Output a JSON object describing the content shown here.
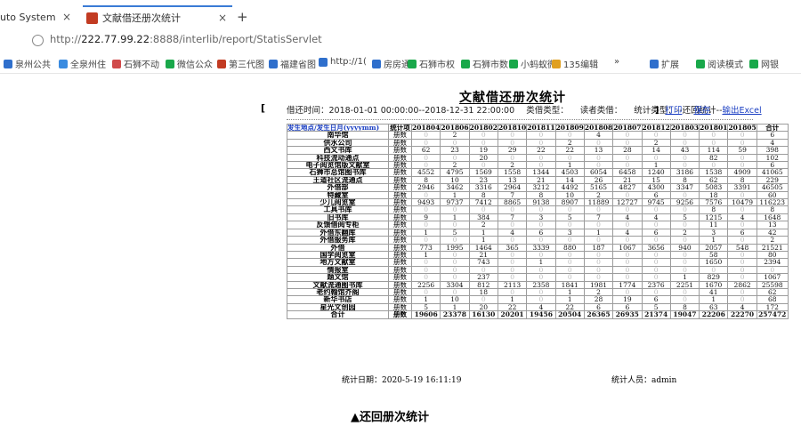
{
  "browser": {
    "tab1_title": "uto System",
    "tab2_title": "文献借还册次统计",
    "new_tab": "+",
    "url_prefix": "http://",
    "url_host": "222.77.99.22",
    "url_rest": ":8888/interlib/report/StatisServlet",
    "bookmarks": [
      "泉州公共",
      "全泉州住",
      "石狮不动",
      "微信公众",
      "第三代图",
      "福建省图",
      "http://1(",
      "房房通",
      "石狮市权",
      "石狮市数",
      "小蚂蚁微",
      "135编辑",
      "»",
      "扩展",
      "阅读模式",
      "网银"
    ]
  },
  "report": {
    "title": "文献借还册次统计",
    "period_label": "借还时间：2018-01-01 00:00:00--2018-12-31 22:00:00",
    "kind_label": "类借类型：",
    "reader_label": "读者类借：",
    "stat_type_label": "统计类型：--还回统计--",
    "left_bracket": "[",
    "right_bracket": "]",
    "btn_print": "打印",
    "btn_save": "保存",
    "btn_export": "输出Excel",
    "header_first": "发生地点/发生日月(yyyymm)",
    "header_type": "统计项",
    "months": [
      "201804",
      "201806",
      "201802",
      "201810",
      "201811",
      "201809",
      "201808",
      "201807",
      "201812",
      "201803",
      "201801",
      "201805",
      "合计"
    ],
    "rows": [
      {
        "name": "南华馆",
        "type": "册数",
        "vals": [
          "0",
          "2",
          "0",
          "0",
          "0",
          "0",
          "4",
          "0",
          "0",
          "0",
          "0",
          "0",
          "6"
        ]
      },
      {
        "name": "供水公司",
        "type": "册数",
        "vals": [
          "0",
          "0",
          "0",
          "0",
          "0",
          "2",
          "0",
          "0",
          "2",
          "0",
          "0",
          "0",
          "4"
        ]
      },
      {
        "name": "西文书库",
        "type": "册数",
        "vals": [
          "62",
          "23",
          "19",
          "29",
          "22",
          "22",
          "13",
          "28",
          "14",
          "43",
          "114",
          "59",
          "398"
        ]
      },
      {
        "name": "科技流动通点",
        "type": "册数",
        "vals": [
          "0",
          "0",
          "20",
          "0",
          "0",
          "0",
          "0",
          "0",
          "0",
          "0",
          "82",
          "0",
          "102"
        ]
      },
      {
        "name": "电子阅览馆版文献室",
        "type": "册数",
        "vals": [
          "0",
          "2",
          "0",
          "2",
          "0",
          "1",
          "0",
          "0",
          "1",
          "0",
          "0",
          "0",
          "6"
        ]
      },
      {
        "name": "石狮市总馆图书库",
        "type": "册数",
        "vals": [
          "4552",
          "4795",
          "1569",
          "1558",
          "1344",
          "4503",
          "6054",
          "6458",
          "1240",
          "3186",
          "1538",
          "4909",
          "41065"
        ]
      },
      {
        "name": "王道社区流通点",
        "type": "册数",
        "vals": [
          "8",
          "10",
          "23",
          "13",
          "21",
          "14",
          "26",
          "21",
          "15",
          "8",
          "62",
          "8",
          "229"
        ]
      },
      {
        "name": "外借部",
        "type": "册数",
        "vals": [
          "2946",
          "3462",
          "3316",
          "2964",
          "3212",
          "4492",
          "5165",
          "4827",
          "4300",
          "3347",
          "5083",
          "3391",
          "46505"
        ]
      },
      {
        "name": "特藏室",
        "type": "册数",
        "vals": [
          "0",
          "1",
          "8",
          "7",
          "8",
          "10",
          "2",
          "0",
          "6",
          "0",
          "18",
          "0",
          "60"
        ]
      },
      {
        "name": "少儿阅览室",
        "type": "册数",
        "vals": [
          "9493",
          "9737",
          "7412",
          "8865",
          "9138",
          "8907",
          "11889",
          "12727",
          "9745",
          "9256",
          "7576",
          "10479",
          "116223"
        ]
      },
      {
        "name": "工具书库",
        "type": "册数",
        "vals": [
          "0",
          "0",
          "0",
          "0",
          "0",
          "0",
          "0",
          "0",
          "0",
          "0",
          "8",
          "0",
          "8"
        ]
      },
      {
        "name": "旧书库",
        "type": "册数",
        "vals": [
          "9",
          "1",
          "384",
          "7",
          "3",
          "5",
          "7",
          "4",
          "4",
          "5",
          "1215",
          "4",
          "1648"
        ]
      },
      {
        "name": "反馈借阅专柜",
        "type": "册数",
        "vals": [
          "0",
          "0",
          "2",
          "0",
          "0",
          "0",
          "0",
          "0",
          "0",
          "0",
          "11",
          "0",
          "13"
        ]
      },
      {
        "name": "外借东翻库",
        "type": "册数",
        "vals": [
          "1",
          "5",
          "1",
          "4",
          "6",
          "3",
          "1",
          "4",
          "6",
          "2",
          "3",
          "6",
          "42"
        ]
      },
      {
        "name": "外借服务库",
        "type": "册数",
        "vals": [
          "0",
          "0",
          "1",
          "0",
          "0",
          "0",
          "0",
          "0",
          "0",
          "0",
          "1",
          "0",
          "2"
        ]
      },
      {
        "name": "外借",
        "type": "册数",
        "vals": [
          "773",
          "1995",
          "1464",
          "365",
          "3339",
          "880",
          "187",
          "1067",
          "3656",
          "940",
          "2057",
          "548",
          "21521"
        ]
      },
      {
        "name": "国学阅览室",
        "type": "册数",
        "vals": [
          "1",
          "0",
          "21",
          "0",
          "0",
          "0",
          "0",
          "0",
          "0",
          "0",
          "58",
          "0",
          "80"
        ]
      },
      {
        "name": "地方文献室",
        "type": "册数",
        "vals": [
          "0",
          "0",
          "743",
          "0",
          "1",
          "0",
          "0",
          "0",
          "0",
          "0",
          "1650",
          "0",
          "2394"
        ]
      },
      {
        "name": "情报室",
        "type": "册数",
        "vals": [
          "0",
          "0",
          "0",
          "0",
          "0",
          "0",
          "0",
          "0",
          "0",
          "0",
          "0",
          "0",
          "0"
        ]
      },
      {
        "name": "题文馆",
        "type": "册数",
        "vals": [
          "0",
          "0",
          "237",
          "0",
          "0",
          "0",
          "0",
          "0",
          "0",
          "1",
          "829",
          "0",
          "1067"
        ]
      },
      {
        "name": "文献流通图书库",
        "type": "册数",
        "vals": [
          "2256",
          "3304",
          "812",
          "2113",
          "2358",
          "1841",
          "1981",
          "1774",
          "2376",
          "2251",
          "1670",
          "2862",
          "25598"
        ]
      },
      {
        "name": "老约翰馆芥阁",
        "type": "册数",
        "vals": [
          "0",
          "0",
          "18",
          "0",
          "0",
          "1",
          "2",
          "0",
          "0",
          "0",
          "41",
          "0",
          "62"
        ]
      },
      {
        "name": "新华书店",
        "type": "册数",
        "vals": [
          "1",
          "10",
          "0",
          "1",
          "0",
          "1",
          "28",
          "19",
          "6",
          "0",
          "1",
          "0",
          "68"
        ]
      },
      {
        "name": "星光文创园",
        "type": "册数",
        "vals": [
          "5",
          "1",
          "20",
          "22",
          "4",
          "22",
          "6",
          "6",
          "5",
          "8",
          "63",
          "4",
          "172"
        ]
      },
      {
        "name": "合计",
        "type": "册数",
        "vals": [
          "19606",
          "23378",
          "16130",
          "20201",
          "19456",
          "20504",
          "26365",
          "26935",
          "21374",
          "19047",
          "22206",
          "22270",
          "257472"
        ]
      }
    ],
    "footer_date": "统计日期：2020-5-19 16:11:19",
    "footer_user": "统计人员：admin"
  },
  "caption": "▲还回册次统计"
}
